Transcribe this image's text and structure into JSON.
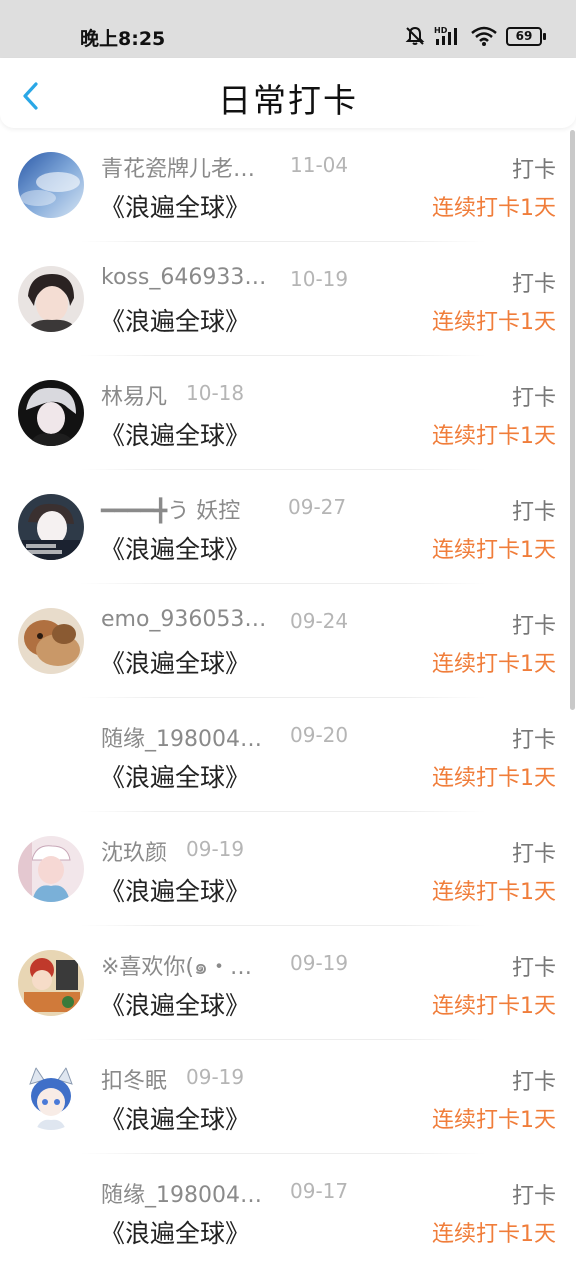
{
  "status_bar": {
    "time": "晚上8:25",
    "battery": "69",
    "network_label": "HD"
  },
  "header": {
    "title": "日常打卡"
  },
  "colors": {
    "accent_blue": "#2aa7e6",
    "streak_orange": "#f07d3a"
  },
  "items": [
    {
      "name": "青花瓷牌儿老…",
      "date": "11-04",
      "book": "《浪遍全球》",
      "action": "打卡",
      "streak": "连续打卡1天",
      "avatar": "sky"
    },
    {
      "name": "koss_646933…",
      "date": "10-19",
      "book": "《浪遍全球》",
      "action": "打卡",
      "streak": "连续打卡1天",
      "avatar": "anime-boy"
    },
    {
      "name": "林易凡",
      "date": "10-18",
      "book": "《浪遍全球》",
      "action": "打卡",
      "streak": "连续打卡1天",
      "avatar": "dark-anime"
    },
    {
      "name": "━━━━╋う 妖控",
      "date": "09-27",
      "book": "《浪遍全球》",
      "action": "打卡",
      "streak": "连续打卡1天",
      "avatar": "face-photo"
    },
    {
      "name": "emo_936053…",
      "date": "09-24",
      "book": "《浪遍全球》",
      "action": "打卡",
      "streak": "连续打卡1天",
      "avatar": "lion"
    },
    {
      "name": "随缘_198004…",
      "date": "09-20",
      "book": "《浪遍全球》",
      "action": "打卡",
      "streak": "连续打卡1天",
      "avatar": "none"
    },
    {
      "name": "沈玖颜",
      "date": "09-19",
      "book": "《浪遍全球》",
      "action": "打卡",
      "streak": "连续打卡1天",
      "avatar": "girl"
    },
    {
      "name": "※喜欢你(๑・…",
      "date": "09-19",
      "book": "《浪遍全球》",
      "action": "打卡",
      "streak": "连续打卡1天",
      "avatar": "colorful"
    },
    {
      "name": "扣冬眠",
      "date": "09-19",
      "book": "《浪遍全球》",
      "action": "打卡",
      "streak": "连续打卡1天",
      "avatar": "cat-boy"
    },
    {
      "name": "随缘_198004…",
      "date": "09-17",
      "book": "《浪遍全球》",
      "action": "打卡",
      "streak": "连续打卡1天",
      "avatar": "none"
    }
  ]
}
